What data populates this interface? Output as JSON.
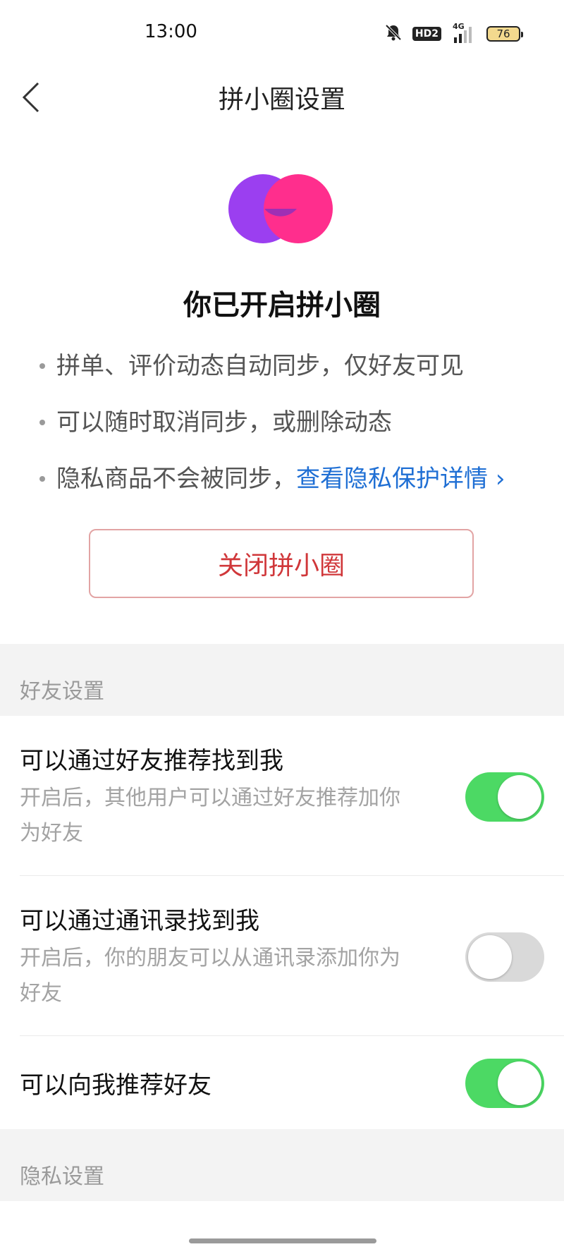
{
  "status_bar": {
    "time": "13:00",
    "hd_badge": "HD2",
    "signal_label": "4G",
    "battery": "76"
  },
  "nav": {
    "title": "拼小圈设置"
  },
  "hero": {
    "title": "你已开启拼小圈",
    "bullets": [
      "拼单、评价动态自动同步，仅好友可见",
      "可以随时取消同步，或删除动态",
      "隐私商品不会被同步，"
    ],
    "privacy_link": "查看隐私保护详情",
    "close_button": "关闭拼小圈"
  },
  "friend_settings": {
    "header": "好友设置",
    "items": [
      {
        "title": "可以通过好友推荐找到我",
        "desc_line1": "开启后，其他用户可以通过好友推荐加你",
        "desc_line2": "为好友",
        "enabled": true
      },
      {
        "title": "可以通过通讯录找到我",
        "desc_line1": "开启后，你的朋友可以从通讯录添加你为",
        "desc_line2": "好友",
        "enabled": false
      },
      {
        "title": "可以向我推荐好友",
        "enabled": true
      }
    ]
  },
  "privacy_settings": {
    "header": "隐私设置"
  },
  "colors": {
    "toggle_on": "#4cd964",
    "toggle_off": "#d9d9d9",
    "link": "#1f6fd4",
    "close_button_text": "#d0373a",
    "logo_left": "#9b3ff0",
    "logo_right": "#ff2e8d"
  }
}
